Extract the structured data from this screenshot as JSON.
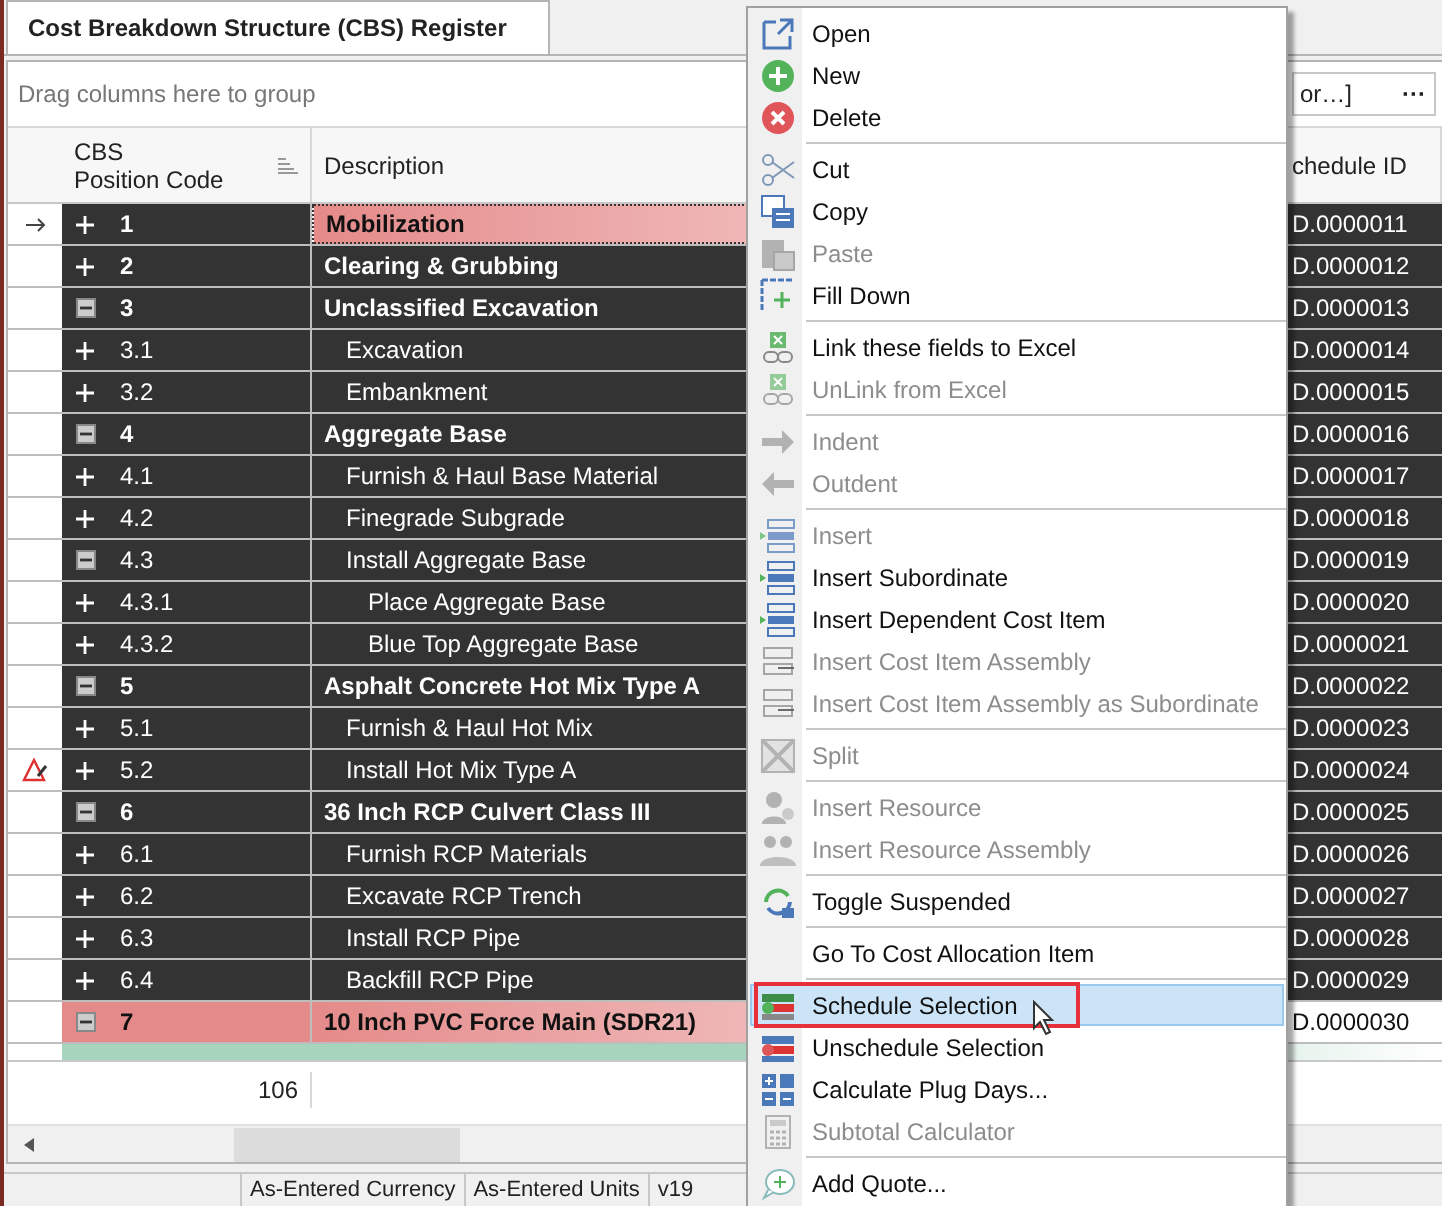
{
  "tab": {
    "title": "Cost Breakdown Structure (CBS) Register",
    "selected": true
  },
  "group_panel": {
    "hint": "Drag columns here to group",
    "field_value": "or…]",
    "field_button": "···"
  },
  "table": {
    "columns": [
      "CBS\nPosition Code",
      "Description",
      "chedule ID"
    ],
    "rows": [
      {
        "code": "1",
        "description": "Mobilization",
        "schedule_id": "D.0000011",
        "expanded": false,
        "current": true,
        "color": "#e58a8a"
      },
      {
        "code": "2",
        "description": "Clearing & Grubbing",
        "schedule_id": "D.0000012",
        "expanded": false
      },
      {
        "code": "3",
        "description": "Unclassified Excavation",
        "schedule_id": "D.0000013",
        "expanded": true,
        "children": [
          {
            "code": "3.1",
            "description": "Excavation",
            "schedule_id": "D.0000014",
            "expanded": false
          },
          {
            "code": "3.2",
            "description": "Embankment",
            "schedule_id": "D.0000015",
            "expanded": false
          }
        ]
      },
      {
        "code": "4",
        "description": "Aggregate Base",
        "schedule_id": "D.0000016",
        "expanded": true,
        "children": [
          {
            "code": "4.1",
            "description": "Furnish & Haul Base Material",
            "schedule_id": "D.0000017",
            "expanded": false
          },
          {
            "code": "4.2",
            "description": "Finegrade Subgrade",
            "schedule_id": "D.0000018",
            "expanded": false
          },
          {
            "code": "4.3",
            "description": "Install Aggregate Base",
            "schedule_id": "D.0000019",
            "expanded": true,
            "children": [
              {
                "code": "4.3.1",
                "description": "Place Aggregate Base",
                "schedule_id": "D.0000020",
                "expanded": false
              },
              {
                "code": "4.3.2",
                "description": "Blue Top Aggregate Base",
                "schedule_id": "D.0000021",
                "expanded": false
              }
            ]
          }
        ]
      },
      {
        "code": "5",
        "description": "Asphalt Concrete Hot Mix Type A",
        "schedule_id": "D.0000022",
        "expanded": true,
        "children": [
          {
            "code": "5.1",
            "description": "Furnish & Haul Hot Mix",
            "schedule_id": "D.0000023",
            "expanded": false
          },
          {
            "code": "5.2",
            "description": "Install Hot Mix Type A",
            "schedule_id": "D.0000024",
            "expanded": false,
            "warning": true
          }
        ]
      },
      {
        "code": "6",
        "description": "36 Inch RCP Culvert Class III",
        "schedule_id": "D.0000025",
        "expanded": true,
        "children": [
          {
            "code": "6.1",
            "description": "Furnish RCP Materials",
            "schedule_id": "D.0000026",
            "expanded": false
          },
          {
            "code": "6.2",
            "description": "Excavate RCP Trench",
            "schedule_id": "D.0000027",
            "expanded": false
          },
          {
            "code": "6.3",
            "description": "Install RCP Pipe",
            "schedule_id": "D.0000028",
            "expanded": false
          },
          {
            "code": "6.4",
            "description": "Backfill RCP Pipe",
            "schedule_id": "D.0000029",
            "expanded": false
          }
        ]
      },
      {
        "code": "7",
        "description": "10 Inch PVC Force Main (SDR21)",
        "schedule_id": "D.0000030",
        "expanded": true,
        "color": "#e58a8a"
      }
    ],
    "partial_row": {
      "color": "#a6d4bd"
    },
    "footer_count": "106"
  },
  "status_bar": [
    "As-Entered Currency",
    "As-Entered Units",
    "v19"
  ],
  "context_menu": [
    {
      "kind": "open",
      "label": "Open",
      "disabled": false,
      "selected": false
    },
    {
      "kind": "new",
      "label": "New",
      "disabled": false,
      "selected": false
    },
    {
      "kind": "delete",
      "label": "Delete",
      "disabled": false,
      "selected": false
    },
    {
      "kind": "separator"
    },
    {
      "kind": "cut",
      "label": "Cut",
      "disabled": false,
      "selected": false
    },
    {
      "kind": "copy",
      "label": "Copy",
      "disabled": false,
      "selected": false
    },
    {
      "kind": "paste",
      "label": "Paste",
      "disabled": true,
      "selected": false
    },
    {
      "kind": "fill",
      "label": "Fill Down",
      "disabled": false,
      "selected": false
    },
    {
      "kind": "separator"
    },
    {
      "kind": "link",
      "label": "Link these fields to Excel",
      "disabled": false,
      "selected": false
    },
    {
      "kind": "link",
      "label": "UnLink from Excel",
      "disabled": true,
      "selected": false
    },
    {
      "kind": "separator"
    },
    {
      "kind": "right",
      "label": "Indent",
      "disabled": true,
      "selected": false
    },
    {
      "kind": "left",
      "label": "Outdent",
      "disabled": true,
      "selected": false
    },
    {
      "kind": "separator"
    },
    {
      "kind": "rows",
      "label": "Insert",
      "disabled": true,
      "selected": false
    },
    {
      "kind": "rows",
      "label": "Insert Subordinate",
      "disabled": false,
      "selected": false
    },
    {
      "kind": "rows",
      "label": "Insert Dependent Cost Item",
      "disabled": false,
      "selected": false
    },
    {
      "kind": "bars",
      "label": "Insert Cost Item Assembly",
      "disabled": true,
      "selected": false
    },
    {
      "kind": "bars",
      "label": "Insert Cost Item Assembly as Subordinate",
      "disabled": true,
      "selected": false
    },
    {
      "kind": "separator"
    },
    {
      "kind": "split",
      "label": "Split",
      "disabled": true,
      "selected": false
    },
    {
      "kind": "separator"
    },
    {
      "kind": "person",
      "label": "Insert Resource",
      "disabled": true,
      "selected": false
    },
    {
      "kind": "people",
      "label": "Insert Resource Assembly",
      "disabled": true,
      "selected": false
    },
    {
      "kind": "separator"
    },
    {
      "kind": "toggle",
      "label": "Toggle Suspended",
      "disabled": false,
      "selected": false
    },
    {
      "kind": "separator"
    },
    {
      "kind": "plain",
      "label": "Go To Cost Allocation Item",
      "disabled": false,
      "selected": false
    },
    {
      "kind": "separator"
    },
    {
      "kind": "schedule",
      "label": "Schedule Selection",
      "disabled": false,
      "selected": true,
      "callout": true
    },
    {
      "kind": "unschedule",
      "label": "Unschedule Selection",
      "disabled": false,
      "selected": false
    },
    {
      "kind": "calc",
      "label": "Calculate Plug Days...",
      "disabled": false,
      "selected": false
    },
    {
      "kind": "calculator",
      "label": "Subtotal Calculator",
      "disabled": true,
      "selected": false
    },
    {
      "kind": "separator"
    },
    {
      "kind": "quote",
      "label": "Add Quote...",
      "disabled": false,
      "selected": false
    }
  ]
}
